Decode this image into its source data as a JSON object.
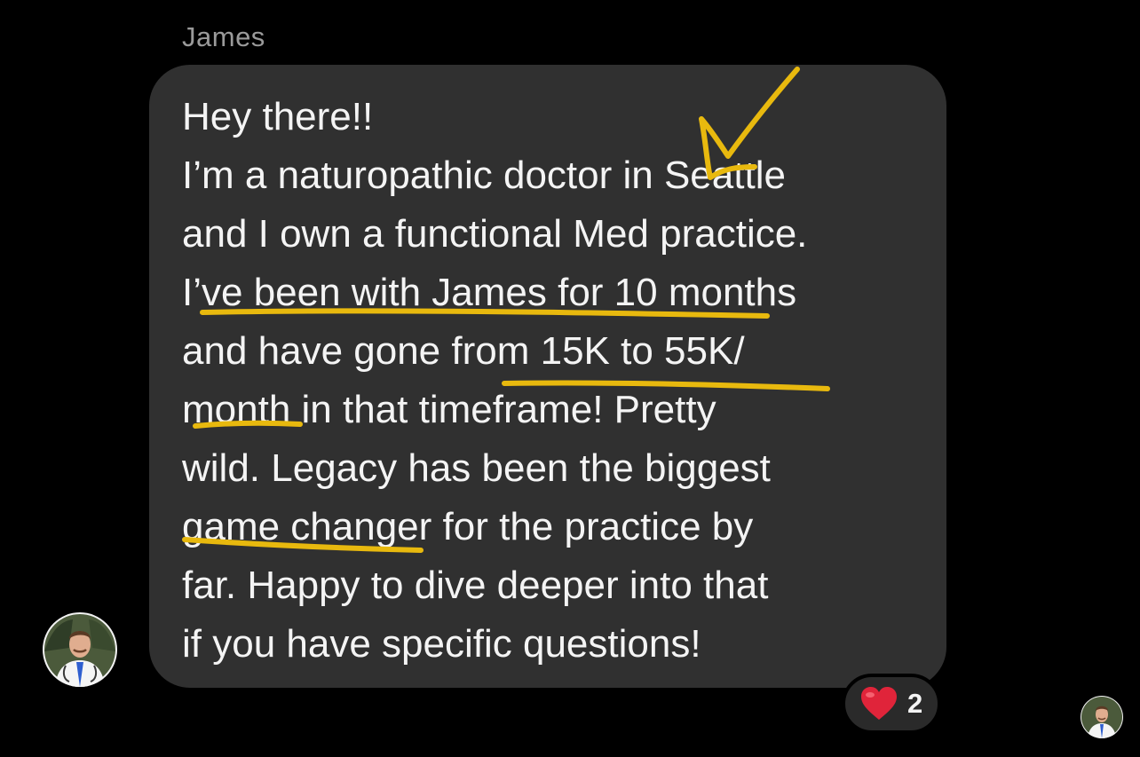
{
  "thread": {
    "sender_name": "James"
  },
  "message": {
    "lines": [
      "Hey there!!",
      "I’m a naturopathic doctor in Seattle",
      "and I own a functional Med practice.",
      "I’ve been with James for 10 months",
      "and have gone from 15K to 55K/",
      "month in that timeframe!  Pretty",
      "wild.  Legacy has been the biggest",
      "game changer for the practice by",
      "far.  Happy to dive deeper into that",
      "if you have specific questions!"
    ],
    "bubble_color": "#303030",
    "text_color": "#f4f4f4"
  },
  "annotations": {
    "highlight_color": "#e8b90e",
    "marks": [
      "checkmark",
      "underline",
      "underline",
      "underline",
      "underline"
    ]
  },
  "reactions": {
    "icon": "heart-icon",
    "count": "2"
  },
  "avatars": {
    "sender_avatar": "profile-photo",
    "read_receipt_avatar": "profile-photo"
  }
}
